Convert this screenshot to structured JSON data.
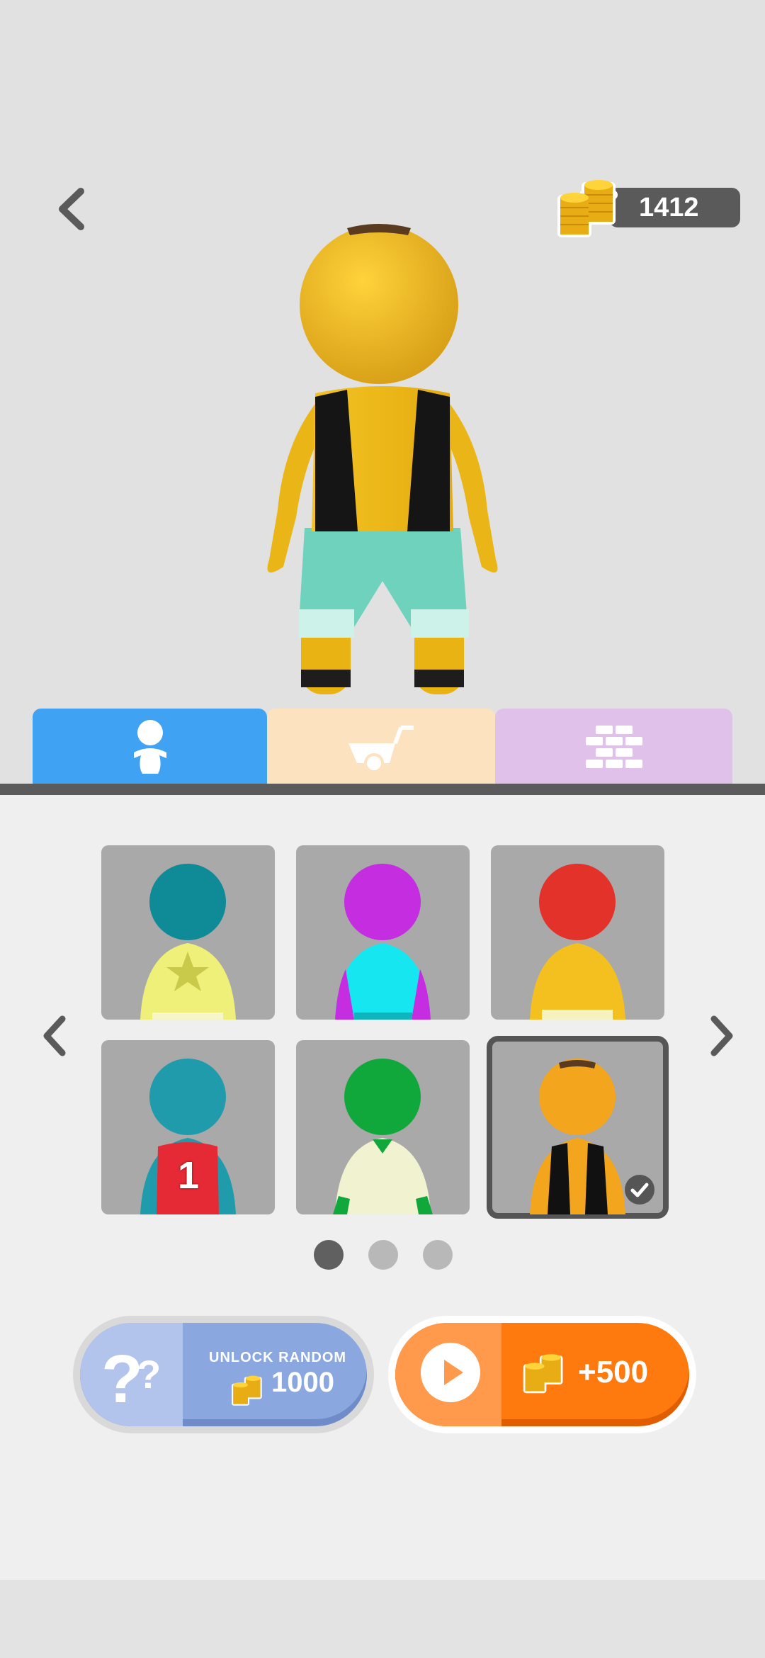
{
  "header": {
    "coins": "1412"
  },
  "tabs": [
    {
      "name": "characters",
      "icon": "person-icon",
      "color": "#3fa2f2"
    },
    {
      "name": "carts",
      "icon": "cart-icon",
      "color": "#fde2c0"
    },
    {
      "name": "walls",
      "icon": "bricks-icon",
      "color": "#e0c1e9"
    }
  ],
  "skins": [
    {
      "head_color": "#0e8b97",
      "shirt_color": "#eef07a",
      "decoration": "star",
      "selected": false
    },
    {
      "head_color": "#c42de0",
      "shirt_color": "#15e6f0",
      "decoration": "purple-sleeves",
      "selected": false
    },
    {
      "head_color": "#e2322a",
      "shirt_color": "#f4c020",
      "decoration": "none",
      "selected": false
    },
    {
      "head_color": "#1f9bab",
      "shirt_color": "#e62a35",
      "decoration": "number-1",
      "number": "1",
      "selected": false
    },
    {
      "head_color": "#10a83a",
      "shirt_color": "#f1f2cf",
      "decoration": "green-hands",
      "selected": false
    },
    {
      "head_color": "#f2a51d",
      "shirt_color": "#111111",
      "decoration": "vest",
      "selected": true
    }
  ],
  "pagination": {
    "current": 1,
    "total": 3
  },
  "unlock_button": {
    "label": "UNLOCK RANDOM",
    "price": "1000"
  },
  "ad_button": {
    "reward": "+500"
  },
  "colors": {
    "tab_bar": "#5b5b5b",
    "selected_border": "#555555",
    "unlock_bg": "#8aa8df",
    "ad_bg": "#ff7a0e"
  }
}
